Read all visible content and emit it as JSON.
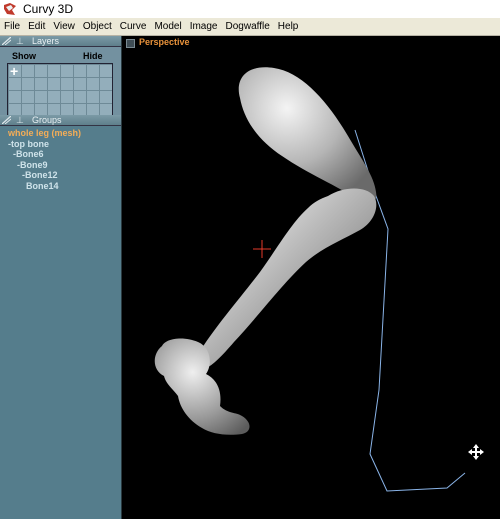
{
  "window": {
    "title": "Curvy 3D"
  },
  "menu": [
    "File",
    "Edit",
    "View",
    "Object",
    "Curve",
    "Model",
    "Image",
    "Dogwaffle",
    "Help"
  ],
  "layers": {
    "title": "Layers",
    "show_label": "Show",
    "hide_label": "Hide"
  },
  "groups": {
    "title": "Groups",
    "root": "whole leg (mesh)",
    "items": [
      "-top bone",
      "-Bone6",
      "-Bone9",
      "-Bone12",
      "Bone14"
    ]
  },
  "viewport": {
    "label": "Perspective"
  },
  "icons": {
    "app": "curvy-app-icon",
    "pin": "pin-icon",
    "add_layer": "plus-icon",
    "cursor": "crosshair-cursor-icon",
    "move": "move-cursor-icon"
  },
  "colors": {
    "accent_orange": "#e8923b",
    "panel_teal": "#557d8c",
    "curve_blue": "#8ab4e8"
  }
}
